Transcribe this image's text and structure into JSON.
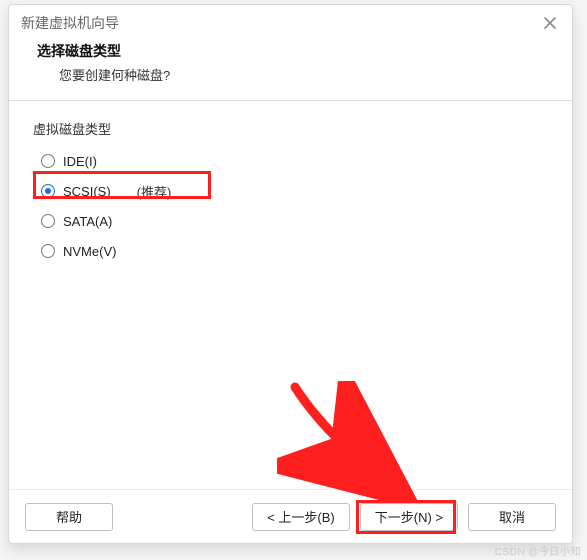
{
  "dialog": {
    "title": "新建虚拟机向导",
    "heading": "选择磁盘类型",
    "subheading": "您要创建何种磁盘?"
  },
  "group": {
    "label": "虚拟磁盘类型",
    "options": [
      {
        "label": "IDE(I)",
        "recommend": "",
        "checked": false
      },
      {
        "label": "SCSI(S)",
        "recommend": "(推荐)",
        "checked": true
      },
      {
        "label": "SATA(A)",
        "recommend": "",
        "checked": false
      },
      {
        "label": "NVMe(V)",
        "recommend": "",
        "checked": false
      }
    ]
  },
  "buttons": {
    "help": "帮助",
    "back": "< 上一步(B)",
    "next": "下一步(N) >",
    "cancel": "取消"
  },
  "watermark": "CSDN @今日小知"
}
